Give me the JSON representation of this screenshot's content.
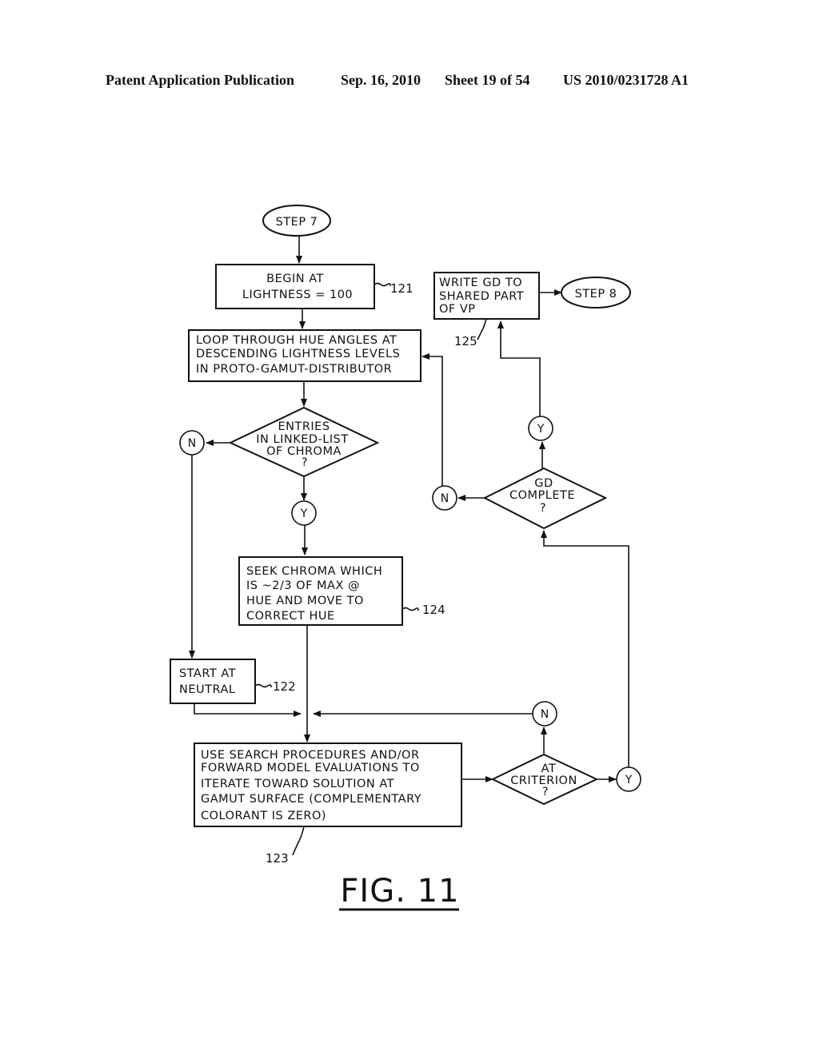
{
  "header": {
    "publication": "Patent Application Publication",
    "date": "Sep. 16, 2010",
    "sheet": "Sheet 19 of 54",
    "number": "US 2010/0231728 A1"
  },
  "flowchart": {
    "start": "STEP 7",
    "end": "STEP 8",
    "box_121": {
      "lines": [
        "BEGIN AT",
        "LIGHTNESS = 100"
      ],
      "ref": "121"
    },
    "box_loop": {
      "lines": [
        "LOOP THROUGH HUE ANGLES AT",
        "DESCENDING LIGHTNESS LEVELS",
        "IN PROTO-GAMUT-DISTRIBUTOR"
      ]
    },
    "decision_entries": {
      "lines": [
        "ENTRIES",
        "IN LINKED-LIST",
        "OF CHROMA",
        "?"
      ]
    },
    "box_124": {
      "lines": [
        "SEEK CHROMA WHICH",
        "IS ~2/3 OF MAX @",
        "HUE AND MOVE TO",
        "CORRECT HUE"
      ],
      "ref": "124"
    },
    "box_122": {
      "lines": [
        "START AT",
        "NEUTRAL"
      ],
      "ref": "122"
    },
    "box_123": {
      "lines": [
        "USE SEARCH PROCEDURES AND/OR",
        "FORWARD MODEL EVALUATIONS TO",
        "ITERATE TOWARD SOLUTION AT",
        "GAMUT SURFACE (COMPLEMENTARY",
        "COLORANT IS ZERO)"
      ],
      "ref": "123"
    },
    "decision_criterion": {
      "lines": [
        "AT",
        "CRITERION",
        "?"
      ]
    },
    "decision_gd": {
      "lines": [
        "GD",
        "COMPLETE",
        "?"
      ]
    },
    "box_125": {
      "lines": [
        "WRITE GD TO",
        "SHARED PART",
        "OF VP"
      ],
      "ref": "125"
    },
    "yes": "Y",
    "no": "N"
  },
  "figure_label": "FIG. 11"
}
